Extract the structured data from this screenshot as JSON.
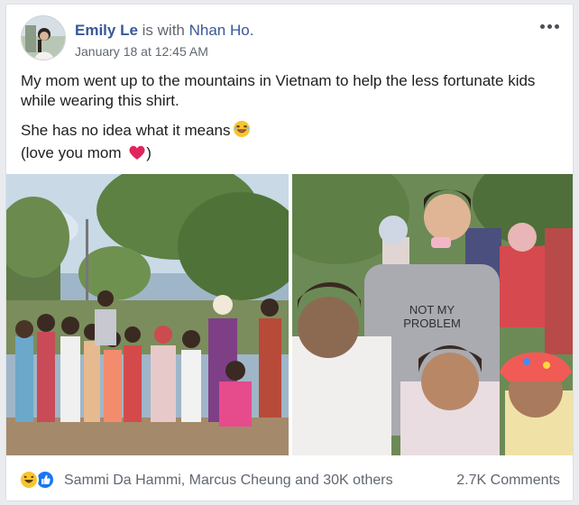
{
  "post": {
    "author": "Emily Le",
    "with_text": " is with ",
    "tagged": "Nhan Ho.",
    "timestamp": "January 18 at 12:45 AM",
    "paragraphs": [
      "My mom went up to the mountains in Vietnam to help the less fortunate kids while wearing this shirt.",
      "She has no idea what it means",
      "(love you mom",
      ")"
    ],
    "shirt_text": "NOT MY PROBLEM"
  },
  "icons": {
    "more": "more-options-icon",
    "laugh": "laughing-emoji-icon",
    "heart": "red-heart-emoji-icon",
    "haha": "haha-reaction-icon",
    "like": "like-reaction-icon"
  },
  "footer": {
    "reactors": "Sammi Da Hammi, Marcus Cheung and 30K others",
    "comments": "2.7K Comments"
  },
  "colors": {
    "link": "#385898",
    "like": "#1877f2",
    "haha": "#f7c531",
    "heart": "#e0245e"
  }
}
